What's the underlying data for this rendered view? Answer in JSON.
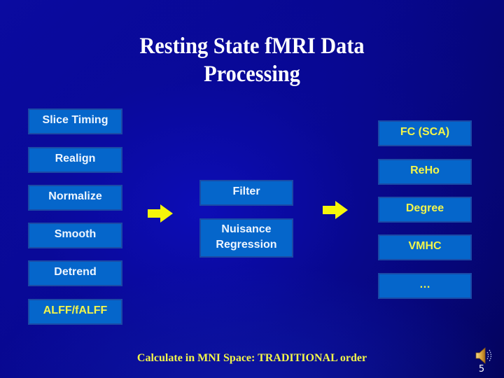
{
  "slide": {
    "title_line1": "Resting State fMRI Data",
    "title_line2": "Processing",
    "preprocessing_steps": [
      {
        "label": "Slice Timing",
        "color": "white"
      },
      {
        "label": "Realign",
        "color": "white"
      },
      {
        "label": "Normalize",
        "color": "white"
      },
      {
        "label": "Smooth",
        "color": "white"
      },
      {
        "label": "Detrend",
        "color": "white"
      },
      {
        "label": "ALFF/fALFF",
        "color": "yellow"
      }
    ],
    "middle_steps": [
      {
        "label": "Filter"
      },
      {
        "label_line1": "Nuisance",
        "label_line2": "Regression"
      }
    ],
    "metrics": [
      {
        "label": "FC (SCA)"
      },
      {
        "label": "ReHo"
      },
      {
        "label": "Degree"
      },
      {
        "label": "VMHC"
      },
      {
        "label": "…"
      }
    ],
    "arrows": [
      "arrow-right-icon",
      "arrow-right-icon"
    ],
    "footer": "Calculate in MNI Space: TRADITIONAL order",
    "speaker_icon": "speaker-icon",
    "page_number": "5",
    "colors": {
      "box_fill": "#0566cb",
      "box_border": "#1a4aa6",
      "text_white": "#eef6ff",
      "text_yellow": "#f2f54a",
      "arrow": "#f5f50a",
      "background": "#07078a"
    }
  }
}
